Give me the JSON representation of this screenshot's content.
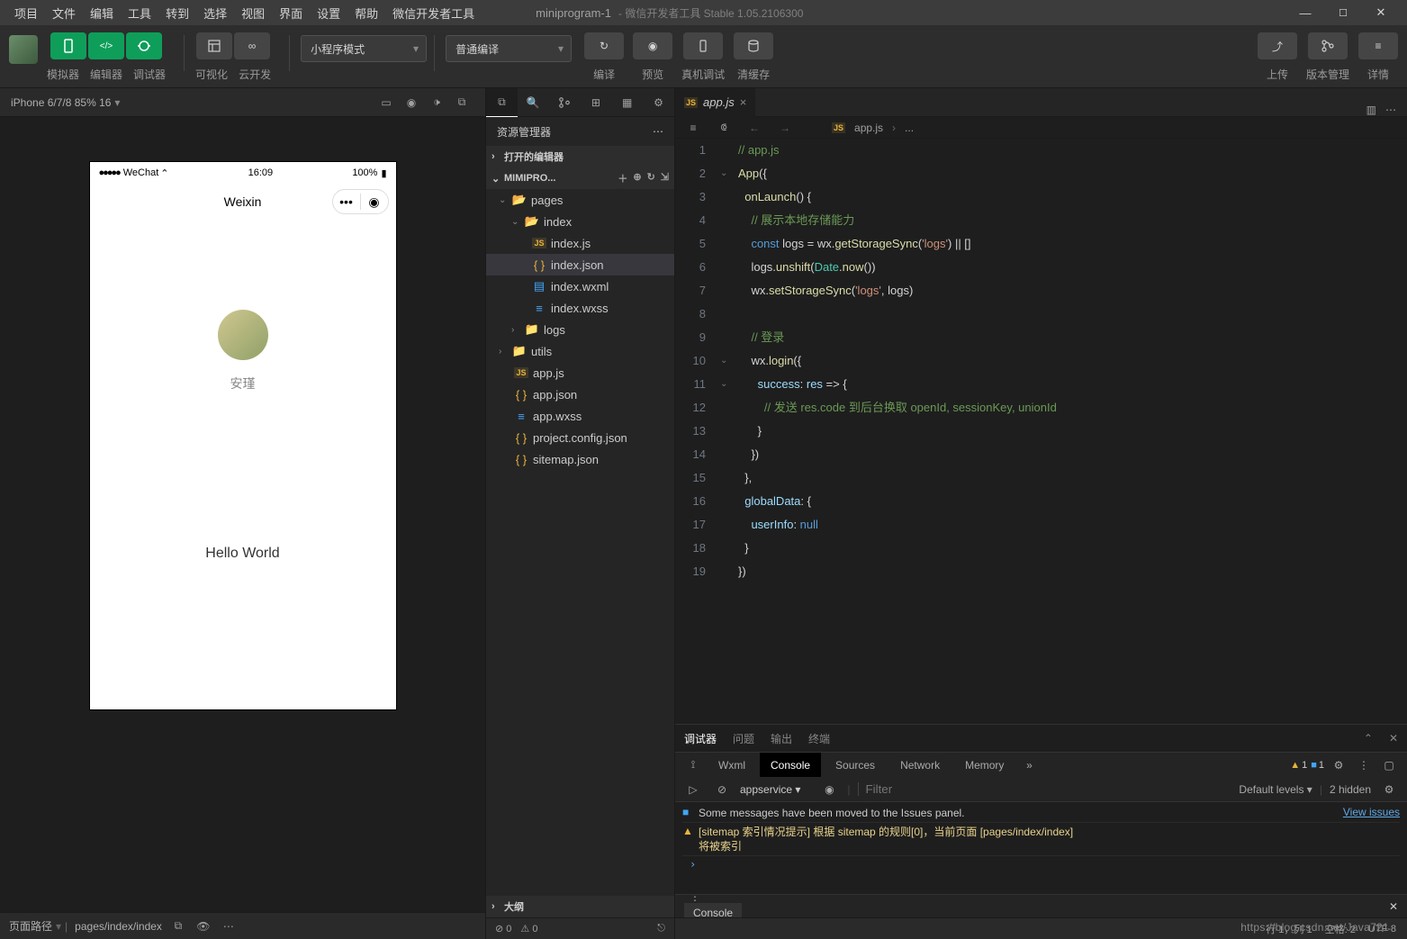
{
  "menus": [
    "项目",
    "文件",
    "编辑",
    "工具",
    "转到",
    "选择",
    "视图",
    "界面",
    "设置",
    "帮助",
    "微信开发者工具"
  ],
  "project_name": "miniprogram-1",
  "app_title": "微信开发者工具 Stable 1.05.2106300",
  "toolbar": {
    "labels": {
      "simulator": "模拟器",
      "editor": "编辑器",
      "debugger": "调试器",
      "visual": "可视化",
      "cloud": "云开发"
    },
    "mode": "小程序模式",
    "compile": "普通编译",
    "right": {
      "compile": "编译",
      "preview": "预览",
      "remote": "真机调试",
      "clear": "清缓存",
      "upload": "上传",
      "version": "版本管理",
      "detail": "详情"
    }
  },
  "simulator": {
    "device": "iPhone 6/7/8 85% 16",
    "status": {
      "carrier": "WeChat",
      "time": "16:09",
      "battery": "100%"
    },
    "nav_title": "Weixin",
    "nickname": "安瑾",
    "hello": "Hello World",
    "footer": {
      "label": "页面路径",
      "path": "pages/index/index"
    }
  },
  "explorer": {
    "title": "资源管理器",
    "open_editors": "打开的编辑器",
    "project": "MIMIPRO...",
    "outline": "大纲",
    "tree": {
      "pages": "pages",
      "index": "index",
      "index_js": "index.js",
      "index_json": "index.json",
      "index_wxml": "index.wxml",
      "index_wxss": "index.wxss",
      "logs": "logs",
      "utils": "utils",
      "app_js": "app.js",
      "app_json": "app.json",
      "app_wxss": "app.wxss",
      "project_config": "project.config.json",
      "sitemap": "sitemap.json"
    },
    "status": {
      "errors": "0",
      "warnings": "0"
    }
  },
  "editor": {
    "tab": "app.js",
    "breadcrumb": {
      "file": "app.js",
      "more": "..."
    },
    "lines": {
      "l1": "// app.js",
      "l2a": "App",
      "l2b": "({",
      "l3a": "onLaunch",
      "l3b": "() {",
      "l4": "// 展示本地存储能力",
      "l5a": "const",
      "l5b": " logs ",
      "l5c": "=",
      "l5d": " wx.",
      "l5e": "getStorageSync",
      "l5f": "(",
      "l5g": "'logs'",
      "l5h": ") || []",
      "l6a": "logs.",
      "l6b": "unshift",
      "l6c": "(",
      "l6d": "Date",
      "l6e": ".",
      "l6f": "now",
      "l6g": "())",
      "l7a": "wx.",
      "l7b": "setStorageSync",
      "l7c": "(",
      "l7d": "'logs'",
      "l7e": ", logs)",
      "l9": "// 登录",
      "l10a": "wx.",
      "l10b": "login",
      "l10c": "({",
      "l11a": "success",
      "l11b": ": ",
      "l11c": "res",
      "l11d": " => {",
      "l12a": "// 发送 res.code 到后台换取 openId, sessionKey, unionId",
      "l13": "}",
      "l14": "})",
      "l15": "},",
      "l16a": "globalData",
      "l16b": ": {",
      "l17a": "userInfo",
      "l17b": ": ",
      "l17c": "null",
      "l18": "}",
      "l19": "})"
    },
    "status": {
      "pos": "行 1，列 1",
      "spaces": "空格: 2",
      "enc": "UTF-8"
    }
  },
  "debugger": {
    "tabs": {
      "debugger": "调试器",
      "issues": "问题",
      "output": "输出",
      "terminal": "终端"
    },
    "devtools": [
      "Wxml",
      "Console",
      "Sources",
      "Network",
      "Memory"
    ],
    "badge_warn": "1",
    "badge_info": "1",
    "context": "appservice",
    "filter_ph": "Filter",
    "levels": "Default levels",
    "hidden": "2 hidden",
    "msg_issues": "Some messages have been moved to the Issues panel.",
    "view_issues": "View issues",
    "sitemap_prefix": "[sitemap 索引情况提示] 根据 sitemap 的规则[0]，当前页面 [pages/index/index]",
    "sitemap_cont": "将被索引",
    "drawer": "Console"
  },
  "watermark": "https://blog.csdn.net/Java721"
}
